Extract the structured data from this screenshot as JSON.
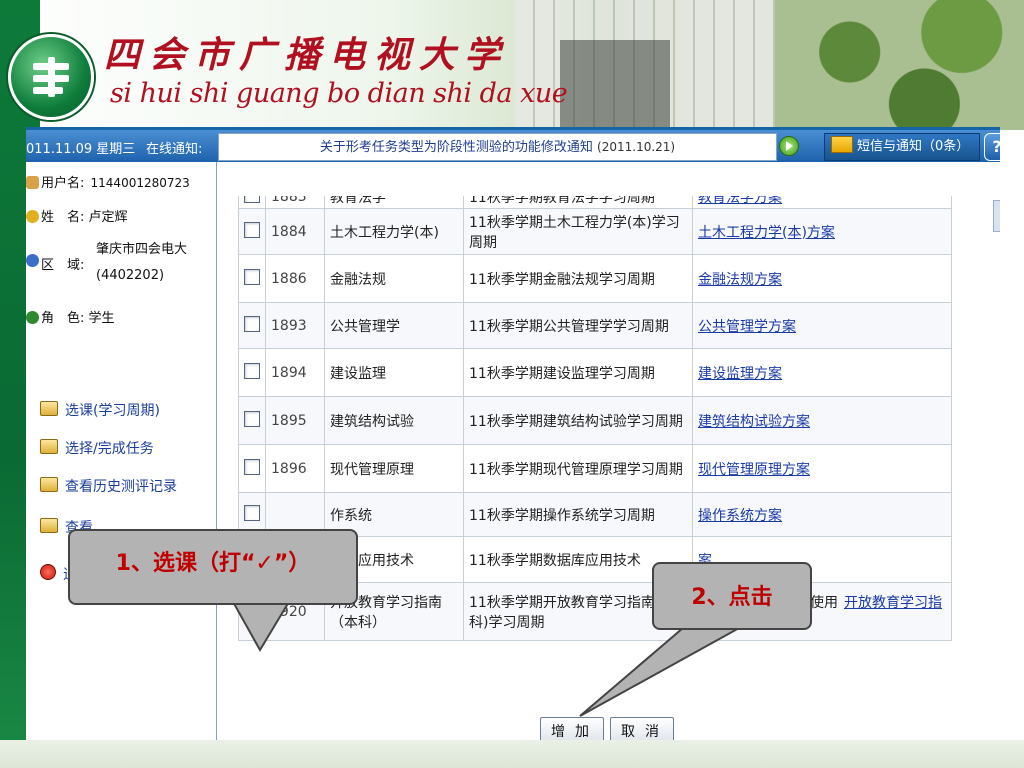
{
  "header": {
    "title_cn": "四会市广播电视大学",
    "title_pinyin": "si hui shi guang bo dian shi da xue"
  },
  "top_bar": {
    "date": "011.11.09 星期三",
    "notice_label": "在线通知:",
    "notice_text": "关于形考任务类型为阶段性测验的功能修改通知",
    "notice_date": "(2011.10.21)",
    "sms_label": "短信与通知（0条）",
    "help_label": "?"
  },
  "user_info": {
    "username_label": "用户名:",
    "username": "1144001280723",
    "name_label": "姓　名:",
    "name": "卢定辉",
    "region_label": "区　域:",
    "region_line1": "肇庆市四会电大",
    "region_line2": "(4402202)",
    "role_label": "角　色:",
    "role": "学生"
  },
  "menu": [
    {
      "label": "选课(学习周期)"
    },
    {
      "label": "选择/完成任务"
    },
    {
      "label": "查看历史测评记录"
    },
    {
      "label": "查看",
      "partial": true
    },
    {
      "label": "退",
      "partial": true
    }
  ],
  "courses": [
    {
      "id": "1883",
      "name": "教育法学",
      "period": "11秋季学期教育法学学习周期",
      "note": "",
      "plan": "教育法学方案",
      "checked": false
    },
    {
      "id": "1884",
      "name": "土木工程力学(本)",
      "period": "11秋季学期土木工程力学(本)学习周期",
      "note": "",
      "plan": "土木工程力学(本)方案",
      "checked": false
    },
    {
      "id": "1886",
      "name": "金融法规",
      "period": "11秋季学期金融法规学习周期",
      "note": "",
      "plan": "金融法规方案",
      "checked": false
    },
    {
      "id": "1893",
      "name": "公共管理学",
      "period": "11秋季学期公共管理学学习周期",
      "note": "",
      "plan": "公共管理学方案",
      "checked": false
    },
    {
      "id": "1894",
      "name": "建设监理",
      "period": "11秋季学期建设监理学习周期",
      "note": "",
      "plan": "建设监理方案",
      "checked": false
    },
    {
      "id": "1895",
      "name": "建筑结构试验",
      "period": "11秋季学期建筑结构试验学习周期",
      "note": "",
      "plan": "建筑结构试验方案",
      "checked": false
    },
    {
      "id": "1896",
      "name": "现代管理原理",
      "period": "11秋季学期现代管理原理学习周期",
      "note": "",
      "plan": "现代管理原理方案",
      "checked": false
    },
    {
      "id": "",
      "name": "作系统",
      "period": "11秋季学期操作系统学习周期",
      "note": "",
      "plan": "操作系统方案",
      "checked": false
    },
    {
      "id": "",
      "name": "据库应用技术",
      "period": "11秋季学期数据库应用技术",
      "note": "",
      "plan": "案",
      "checked": false
    },
    {
      "id": "1920",
      "name": "开放教育学习指南（本科）",
      "period": "11秋季学期开放教育学习指南(本科)学习周期",
      "note": "中央电大本科学生使用",
      "plan": "开放教育学习指南（本科）方案",
      "checked": true
    }
  ],
  "buttons": {
    "add": "增加",
    "cancel": "取消"
  },
  "callouts": {
    "step1": "1、选课（打“✓”）",
    "step2": "2、点击"
  },
  "colors": {
    "title_red": "#b0101f",
    "bar_blue": "#1e62ad",
    "link_blue": "#1a3aa8",
    "callout_text": "#c00000"
  }
}
